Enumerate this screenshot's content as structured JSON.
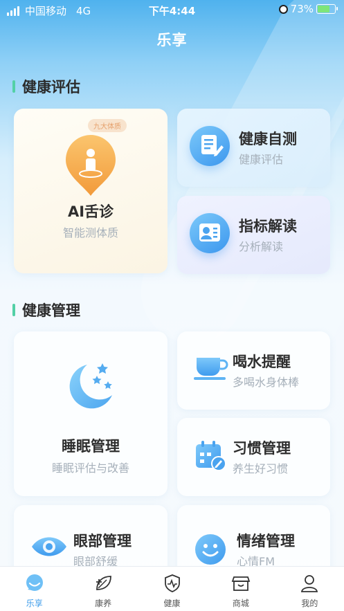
{
  "status_bar": {
    "carrier": "中国移动",
    "network": "4G",
    "time": "下午4:44",
    "battery_percent": "73%",
    "battery_level": 0.73
  },
  "header": {
    "title": "乐享"
  },
  "sections": {
    "assessment": {
      "title": "健康评估"
    },
    "management": {
      "title": "健康管理"
    }
  },
  "assessment_cards": {
    "ai_tongue": {
      "tag": "九大体质",
      "title": "AI舌诊",
      "subtitle": "智能测体质",
      "icon": "person-location-icon"
    },
    "self_test": {
      "title": "健康自测",
      "subtitle": "健康评估",
      "icon": "document-edit-icon"
    },
    "indicator": {
      "title": "指标解读",
      "subtitle": "分析解读",
      "icon": "id-card-icon"
    }
  },
  "management_cards": {
    "sleep": {
      "title": "睡眠管理",
      "subtitle": "睡眠评估与改善",
      "icon": "moon-stars-icon"
    },
    "water": {
      "title": "喝水提醒",
      "subtitle": "多喝水身体棒",
      "icon": "cup-icon"
    },
    "habit": {
      "title": "习惯管理",
      "subtitle": "养生好习惯",
      "icon": "calendar-edit-icon"
    },
    "eye": {
      "title": "眼部管理",
      "subtitle": "眼部舒缓",
      "icon": "eye-icon"
    },
    "emotion": {
      "title": "情绪管理",
      "subtitle": "心情FM",
      "icon": "smile-icon"
    }
  },
  "tabbar": [
    {
      "label": "乐享",
      "icon": "chat-bubble-icon",
      "active": true
    },
    {
      "label": "康养",
      "icon": "leaf-plus-icon",
      "active": false
    },
    {
      "label": "健康",
      "icon": "shield-pulse-icon",
      "active": false
    },
    {
      "label": "商城",
      "icon": "shop-icon",
      "active": false
    },
    {
      "label": "我的",
      "icon": "user-icon",
      "active": false
    }
  ],
  "colors": {
    "accent": "#3b9bea",
    "section_bar": "#53d0a6",
    "tag_bg": "#f8e3cd",
    "tag_text": "#e5a06c"
  }
}
